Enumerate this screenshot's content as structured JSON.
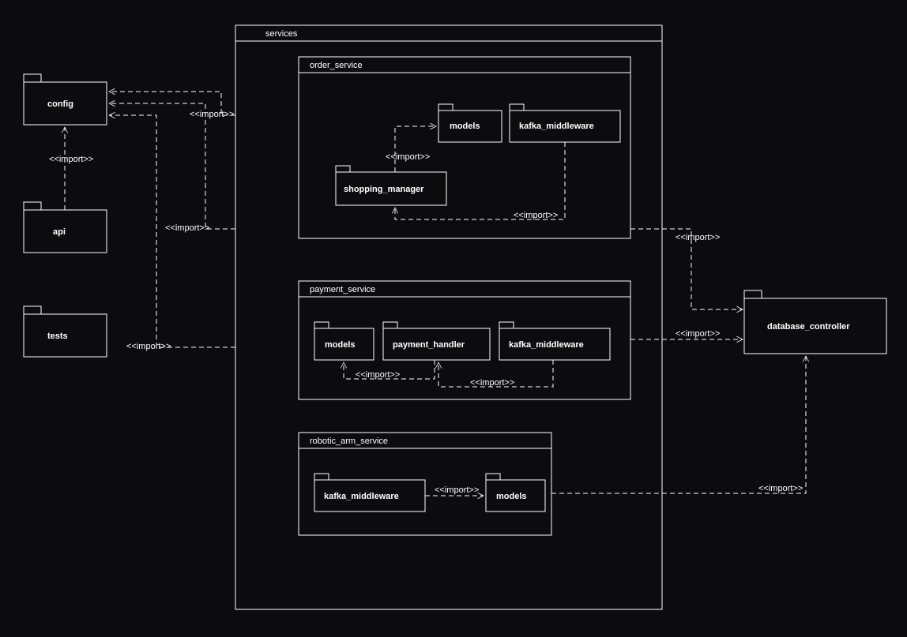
{
  "packages": {
    "config": "config",
    "api": "api",
    "tests": "tests",
    "services": "services",
    "order_service": "order_service",
    "models_order": "models",
    "kafka_order": "kafka_middleware",
    "shopping_manager": "shopping_manager",
    "payment_service": "payment_service",
    "models_pay": "models",
    "payment_handler": "payment_handler",
    "kafka_pay": "kafka_middleware",
    "robotic_arm_service": "robotic_arm_service",
    "kafka_rob": "kafka_middleware",
    "models_rob": "models",
    "database_controller": "database_controller"
  },
  "import_label": "<<import>>"
}
